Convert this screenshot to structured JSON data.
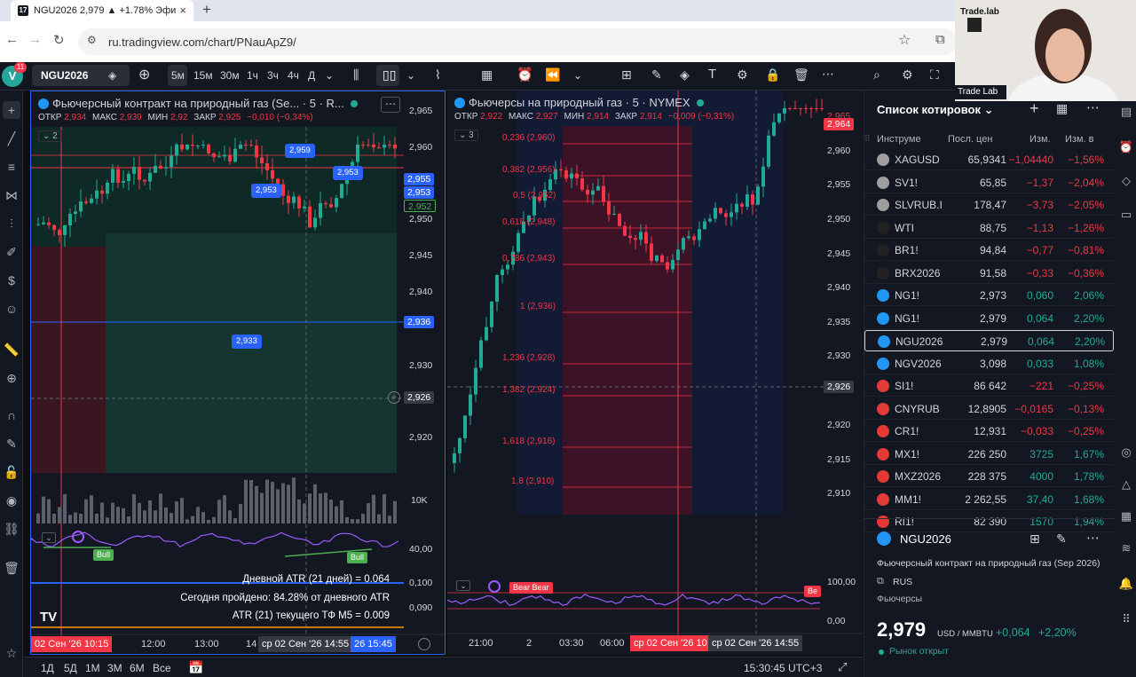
{
  "browser": {
    "tab_title": "NGU2026 2,979 ▲ +1.78% Эфи",
    "tab_favicon": "17",
    "url": "ru.tradingview.com/chart/PNauApZ9/"
  },
  "toolbar": {
    "avatar_letter": "V",
    "notifications": "11",
    "symbol": "NGU2026",
    "timeframes": [
      "5м",
      "15м",
      "30м",
      "1ч",
      "3ч",
      "4ч",
      "Д"
    ]
  },
  "chart_left": {
    "title": "Фьючерсный контракт на природный газ (Se... · 5 · R...",
    "ohlc_labels": [
      "ОТКР",
      "МАКС",
      "МИН",
      "ЗАКР"
    ],
    "ohlc_values": [
      "2,934",
      "2,939",
      "2,92",
      "2,925",
      "−0,010 (−0,34%)"
    ],
    "collapse": "2",
    "y_ticks": [
      "2,965",
      "2,960",
      "2,955",
      "2,950",
      "2,945",
      "2,940",
      "2,935",
      "2,930",
      "2,920",
      "10K",
      "40,00",
      "0,100",
      "0,090"
    ],
    "price_tags": [
      "2,955",
      "2,953",
      "2,952",
      "2,936",
      "2,926"
    ],
    "bubbles": [
      "2,959",
      "2,953",
      "2,953",
      "2,933"
    ],
    "indicator_tags": [
      "Bull",
      "Bull"
    ],
    "atr_lines": [
      "Дневной ATR (21 дней) = 0.064",
      "Сегодня пройдено: 84.28% от дневного ATR",
      "ATR (21) текущего ТФ M5 = 0.009"
    ],
    "x_labels": [
      "12:00",
      "13:00",
      "14"
    ],
    "x_tags": [
      "02 Сен '26  10:15",
      "ср 02 Сен '26   14:55",
      "26  15:45"
    ],
    "logo": "TV"
  },
  "chart_right": {
    "title": "Фьючерсы на природный газ · 5 · NYMEX",
    "ohlc_labels": [
      "ОТКР",
      "МАКС",
      "МИН",
      "ЗАКР"
    ],
    "ohlc_values": [
      "2,922",
      "2,927",
      "2,914",
      "2,914",
      "−0,009 (−0,31%)"
    ],
    "collapse": "3",
    "fib_levels": [
      "0,236 (2,960)",
      "0,382 (2,956)",
      "0,5 (2,952)",
      "0,618 (2,948)",
      "0,786 (2,943)",
      "1 (2,936)",
      "1,236 (2,928)",
      "1,382 (2,924)",
      "1,618 (2,916)",
      "1,8 (2,910)"
    ],
    "y_ticks": [
      "2,960",
      "2,955",
      "2,950",
      "2,945",
      "2,940",
      "2,935",
      "2,930",
      "2,920",
      "2,915",
      "2,910",
      "100,00",
      "0,00"
    ],
    "price_tags": [
      "2,965",
      "2,964",
      "2,926"
    ],
    "indicator_tags": [
      "Bear Bear",
      "Be"
    ],
    "x_labels": [
      "21:00",
      "2",
      "03:30",
      "06:00"
    ],
    "x_tags": [
      "ср 02 Сен '26  10",
      "ср 02 Сен '26   14:55"
    ]
  },
  "bottom_bar": {
    "ranges": [
      "1Д",
      "5Д",
      "1М",
      "3М",
      "6М",
      "Все"
    ],
    "clock": "15:30:45 UTC+3"
  },
  "watchlist": {
    "title": "Список котировок",
    "columns": [
      "Инструме",
      "Посл. цен",
      "Изм.",
      "Изм. в"
    ],
    "rows": [
      {
        "sym": "XAGUSD",
        "last": "65,9341",
        "chg": "−1,04440",
        "pct": "−1,56%",
        "up": false,
        "color": "#9e9e9e"
      },
      {
        "sym": "SV1!",
        "last": "65,85",
        "chg": "−1,37",
        "pct": "−2,04%",
        "up": false,
        "color": "#9e9e9e"
      },
      {
        "sym": "SLVRUB.I",
        "last": "178,47",
        "chg": "−3,73",
        "pct": "−2,05%",
        "up": false,
        "color": "#9e9e9e"
      },
      {
        "sym": "WTI",
        "last": "88,75",
        "chg": "−1,13",
        "pct": "−1,26%",
        "up": false,
        "color": "#222"
      },
      {
        "sym": "BR1!",
        "last": "94,84",
        "chg": "−0,77",
        "pct": "−0,81%",
        "up": false,
        "color": "#222"
      },
      {
        "sym": "BRX2026",
        "last": "91,58",
        "chg": "−0,33",
        "pct": "−0,36%",
        "up": false,
        "color": "#222"
      },
      {
        "sym": "NG1!",
        "last": "2,973",
        "chg": "0,060",
        "pct": "2,06%",
        "up": true,
        "color": "#2196f3"
      },
      {
        "sym": "NG1!",
        "last": "2,979",
        "chg": "0,064",
        "pct": "2,20%",
        "up": true,
        "color": "#2196f3"
      },
      {
        "sym": "NGU2026",
        "last": "2,979",
        "chg": "0,064",
        "pct": "2,20%",
        "up": true,
        "color": "#2196f3"
      },
      {
        "sym": "NGV2026",
        "last": "3,098",
        "chg": "0,033",
        "pct": "1,08%",
        "up": true,
        "color": "#2196f3"
      },
      {
        "sym": "SI1!",
        "last": "86 642",
        "chg": "−221",
        "pct": "−0,25%",
        "up": false,
        "color": "#e53935"
      },
      {
        "sym": "CNYRUB",
        "last": "12,8905",
        "chg": "−0,0165",
        "pct": "−0,13%",
        "up": false,
        "color": "#e53935"
      },
      {
        "sym": "CR1!",
        "last": "12,931",
        "chg": "−0,033",
        "pct": "−0,25%",
        "up": false,
        "color": "#e53935"
      },
      {
        "sym": "MX1!",
        "last": "226 250",
        "chg": "3725",
        "pct": "1,67%",
        "up": true,
        "color": "#e53935"
      },
      {
        "sym": "MXZ2026",
        "last": "228 375",
        "chg": "4000",
        "pct": "1,78%",
        "up": true,
        "color": "#e53935"
      },
      {
        "sym": "MM1!",
        "last": "2 262,55",
        "chg": "37,40",
        "pct": "1,68%",
        "up": true,
        "color": "#e53935"
      },
      {
        "sym": "RI1!",
        "last": "82 390",
        "chg": "1570",
        "pct": "1,94%",
        "up": true,
        "color": "#e53935"
      }
    ],
    "detail": {
      "symbol": "NGU2026",
      "name": "Фьючерсный контракт на природный газ (Sep 2026)",
      "exchange": "RUS",
      "category": "Фьючерсы",
      "price": "2,979",
      "unit": "USD / MMBTU",
      "change": "+0,064",
      "change_pct": "+2,20%",
      "status": "Рынок открыт"
    }
  },
  "webcam": {
    "brand": "Trade.lab",
    "caption": "Trade Lab"
  },
  "colors": {
    "up": "#22ab94",
    "down": "#f23645",
    "accent": "#2962ff",
    "bg": "#131722"
  }
}
